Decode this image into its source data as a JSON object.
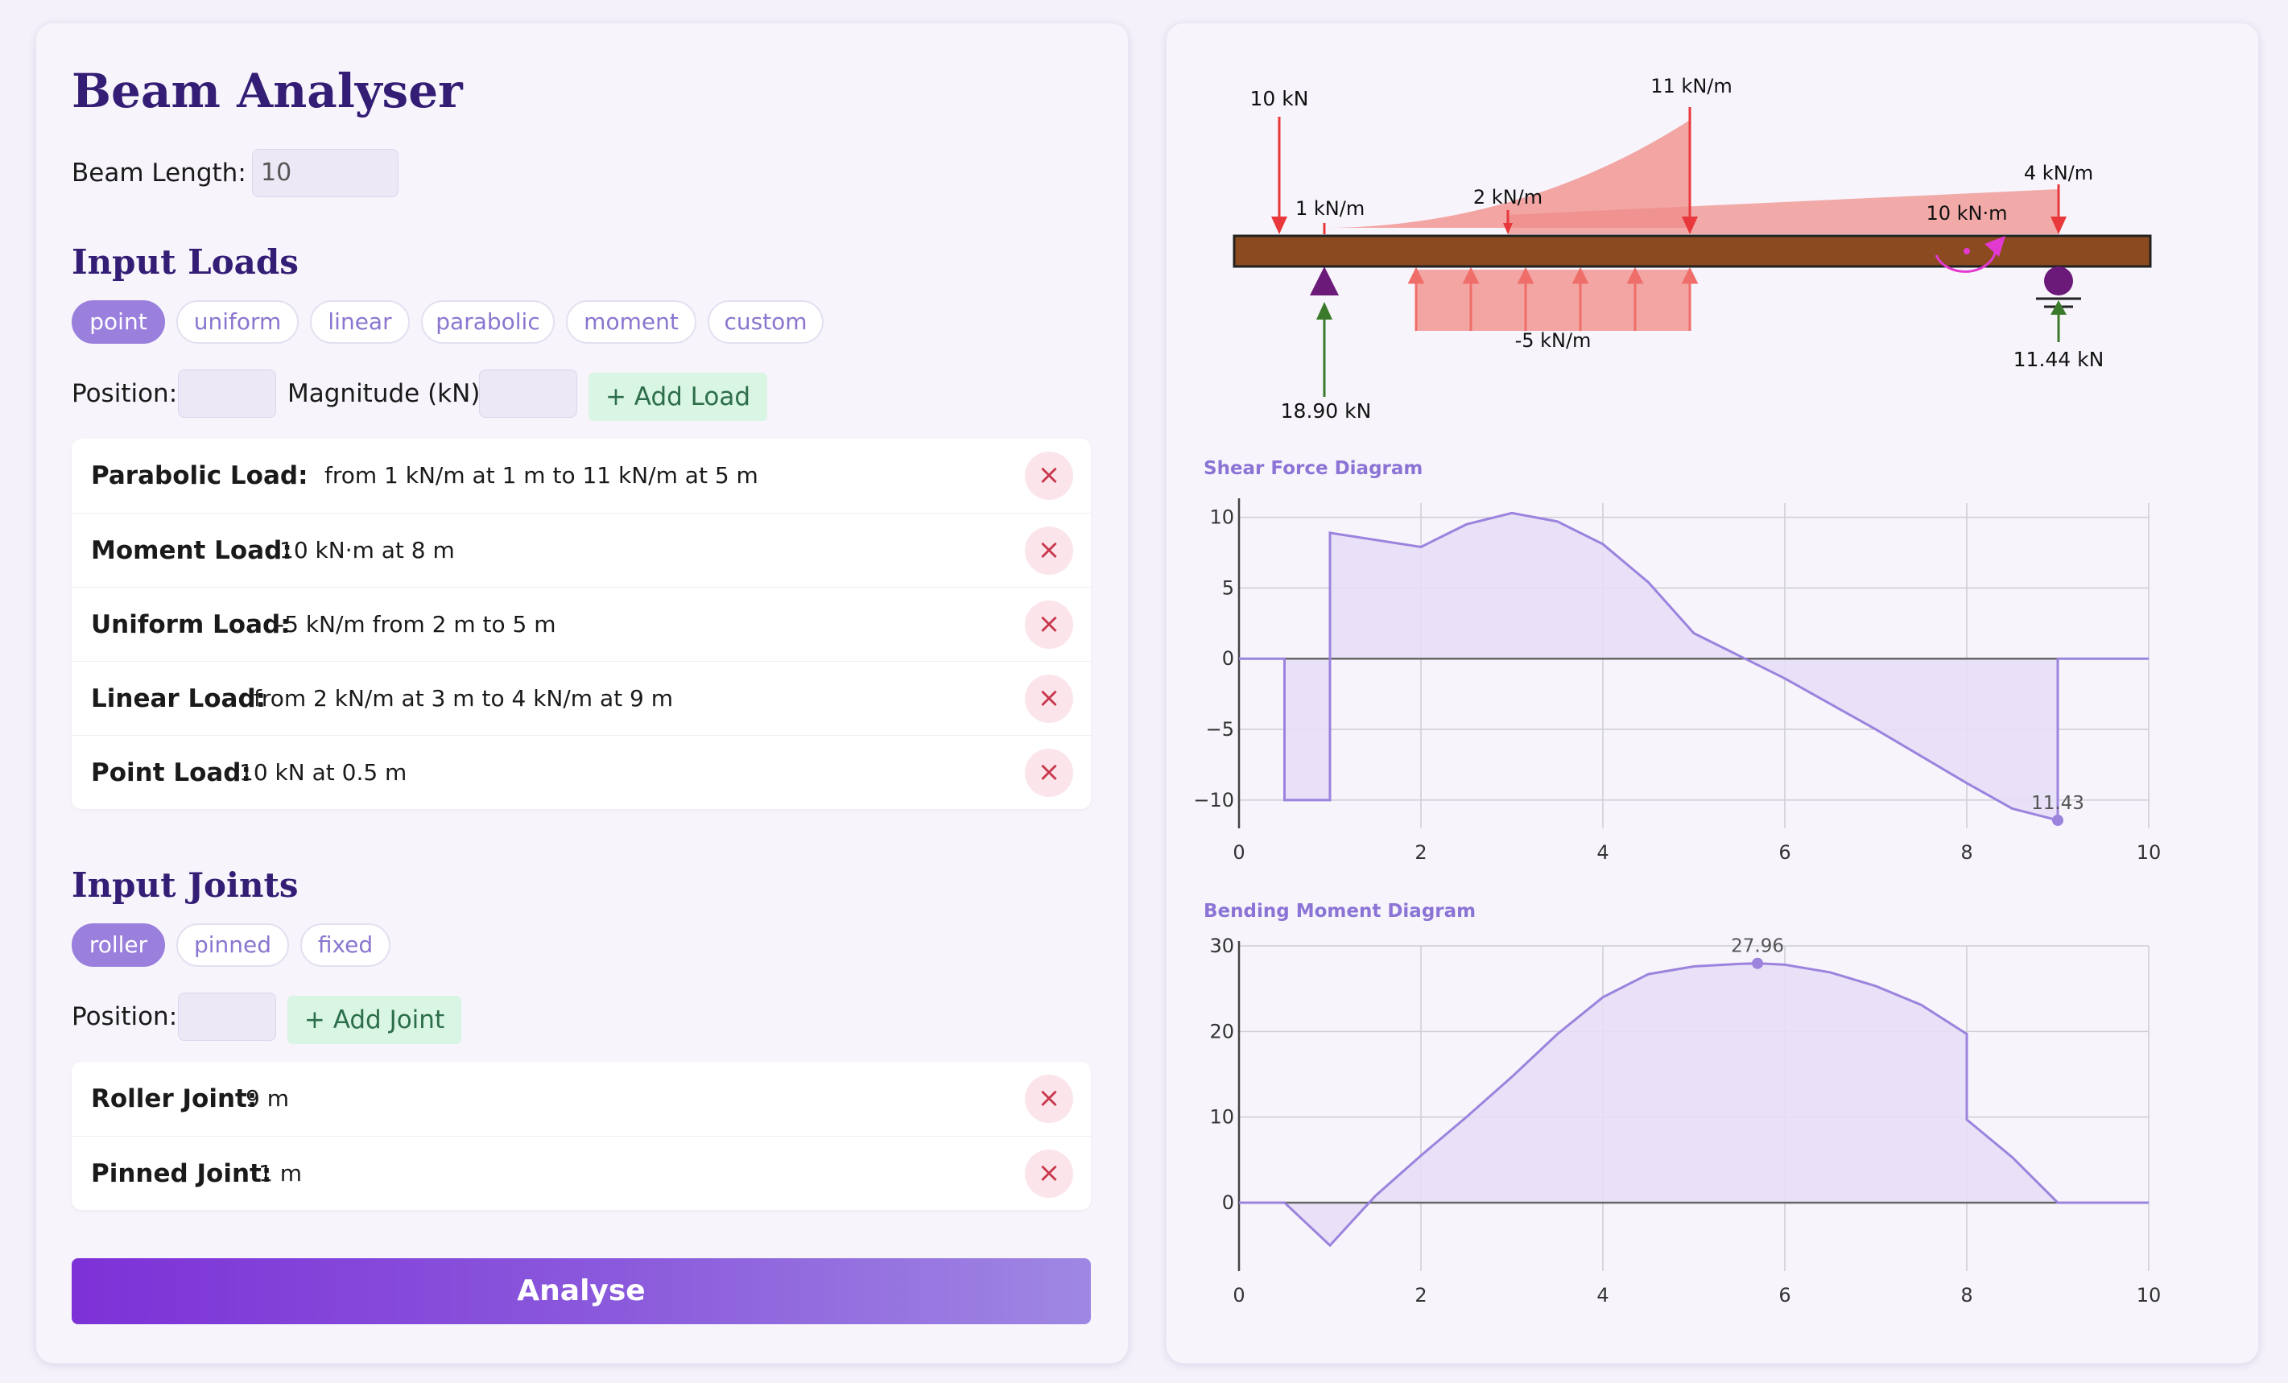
{
  "app": {
    "title": "Beam Analyser",
    "beam_length_label": "Beam Length:",
    "beam_length_value": "10"
  },
  "loads_section": {
    "title": "Input Loads",
    "types": [
      "point",
      "uniform",
      "linear",
      "parabolic",
      "moment",
      "custom"
    ],
    "active_type": "point",
    "position_label": "Position:",
    "magnitude_label": "Magnitude (kN):",
    "add_button": "+ Add Load",
    "items": [
      {
        "type": "Parabolic Load:",
        "desc": "from 1 kN/m at 1 m to 11 kN/m at 5 m"
      },
      {
        "type": "Moment Load:",
        "desc": "10 kN·m at 8 m"
      },
      {
        "type": "Uniform Load:",
        "desc": "-5 kN/m from 2 m to 5 m"
      },
      {
        "type": "Linear Load:",
        "desc": "from 2 kN/m at 3 m to 4 kN/m at 9 m"
      },
      {
        "type": "Point Load:",
        "desc": "10 kN at 0.5 m"
      }
    ],
    "remove_icon": "×"
  },
  "joints_section": {
    "title": "Input Joints",
    "types": [
      "roller",
      "pinned",
      "fixed"
    ],
    "active_type": "roller",
    "position_label": "Position:",
    "add_button": "+ Add Joint",
    "items": [
      {
        "type": "Roller Joint:",
        "desc": "9 m"
      },
      {
        "type": "Pinned Joint:",
        "desc": "1 m"
      }
    ]
  },
  "analyse_button": "Analyse",
  "beam_diagram": {
    "labels": {
      "point_load": "10 kN",
      "parabolic_start": "1 kN/m",
      "parabolic_end": "11 kN/m",
      "linear_start": "2 kN/m",
      "linear_end": "4 kN/m",
      "moment": "10 kN·m",
      "uniform": "-5 kN/m",
      "reaction_pinned": "18.90 kN",
      "reaction_roller": "11.44 kN"
    },
    "colors": {
      "beam": "#8b4a1f",
      "load": "#e8383b",
      "load_fill": "#f08a86",
      "support": "#6b1a7a",
      "reaction": "#3a7a2a",
      "moment": "#e23ad0"
    }
  },
  "chart_data": [
    {
      "type": "line",
      "title": "Shear Force Diagram",
      "x": [
        0,
        0.5,
        0.5,
        1,
        1,
        2,
        2.5,
        3,
        3.5,
        4,
        4.5,
        5,
        5.5,
        6,
        6.5,
        7,
        7.5,
        8,
        8.5,
        9,
        9,
        10
      ],
      "y": [
        0,
        0,
        -10,
        -10,
        8.9,
        7.9,
        9.5,
        10.3,
        9.7,
        8.1,
        5.4,
        1.8,
        0.2,
        -1.4,
        -3.2,
        -5.0,
        -6.9,
        -8.8,
        -10.6,
        -11.43,
        0,
        0
      ],
      "xlim": [
        0,
        10
      ],
      "ylim": [
        -12,
        11
      ],
      "xticks": [
        0,
        2,
        4,
        6,
        8,
        10
      ],
      "yticks": [
        10,
        5,
        0,
        -5,
        -10
      ],
      "ytick_labels": [
        "10",
        "5",
        "0",
        "−5",
        "−10"
      ],
      "annotation": {
        "x": 9,
        "y": -11.43,
        "label": "11.43"
      },
      "grid": true
    },
    {
      "type": "line",
      "title": "Bending Moment Diagram",
      "x": [
        0,
        0.5,
        1,
        1.5,
        2,
        2.5,
        3,
        3.5,
        4,
        4.5,
        5,
        5.5,
        5.7,
        6,
        6.5,
        7,
        7.5,
        8,
        8,
        8.5,
        9,
        10
      ],
      "y": [
        0,
        0,
        -5,
        0.8,
        5.5,
        10.0,
        14.7,
        19.7,
        24,
        26.7,
        27.6,
        27.9,
        27.96,
        27.8,
        26.9,
        25.3,
        23.1,
        19.7,
        9.7,
        5.3,
        0,
        0
      ],
      "xlim": [
        0,
        10
      ],
      "ylim": [
        -8,
        30
      ],
      "xticks": [
        0,
        2,
        4,
        6,
        8,
        10
      ],
      "yticks": [
        30,
        20,
        10,
        0
      ],
      "ytick_labels": [
        "30",
        "20",
        "10",
        "0"
      ],
      "annotation": {
        "x": 5.7,
        "y": 27.96,
        "label": "27.96"
      },
      "grid": true
    }
  ],
  "chart_colors": {
    "line": "#9b83de",
    "fill": "#e6dff6",
    "grid": "#cfcdd5",
    "zero": "#666666",
    "axis": "#444444"
  }
}
